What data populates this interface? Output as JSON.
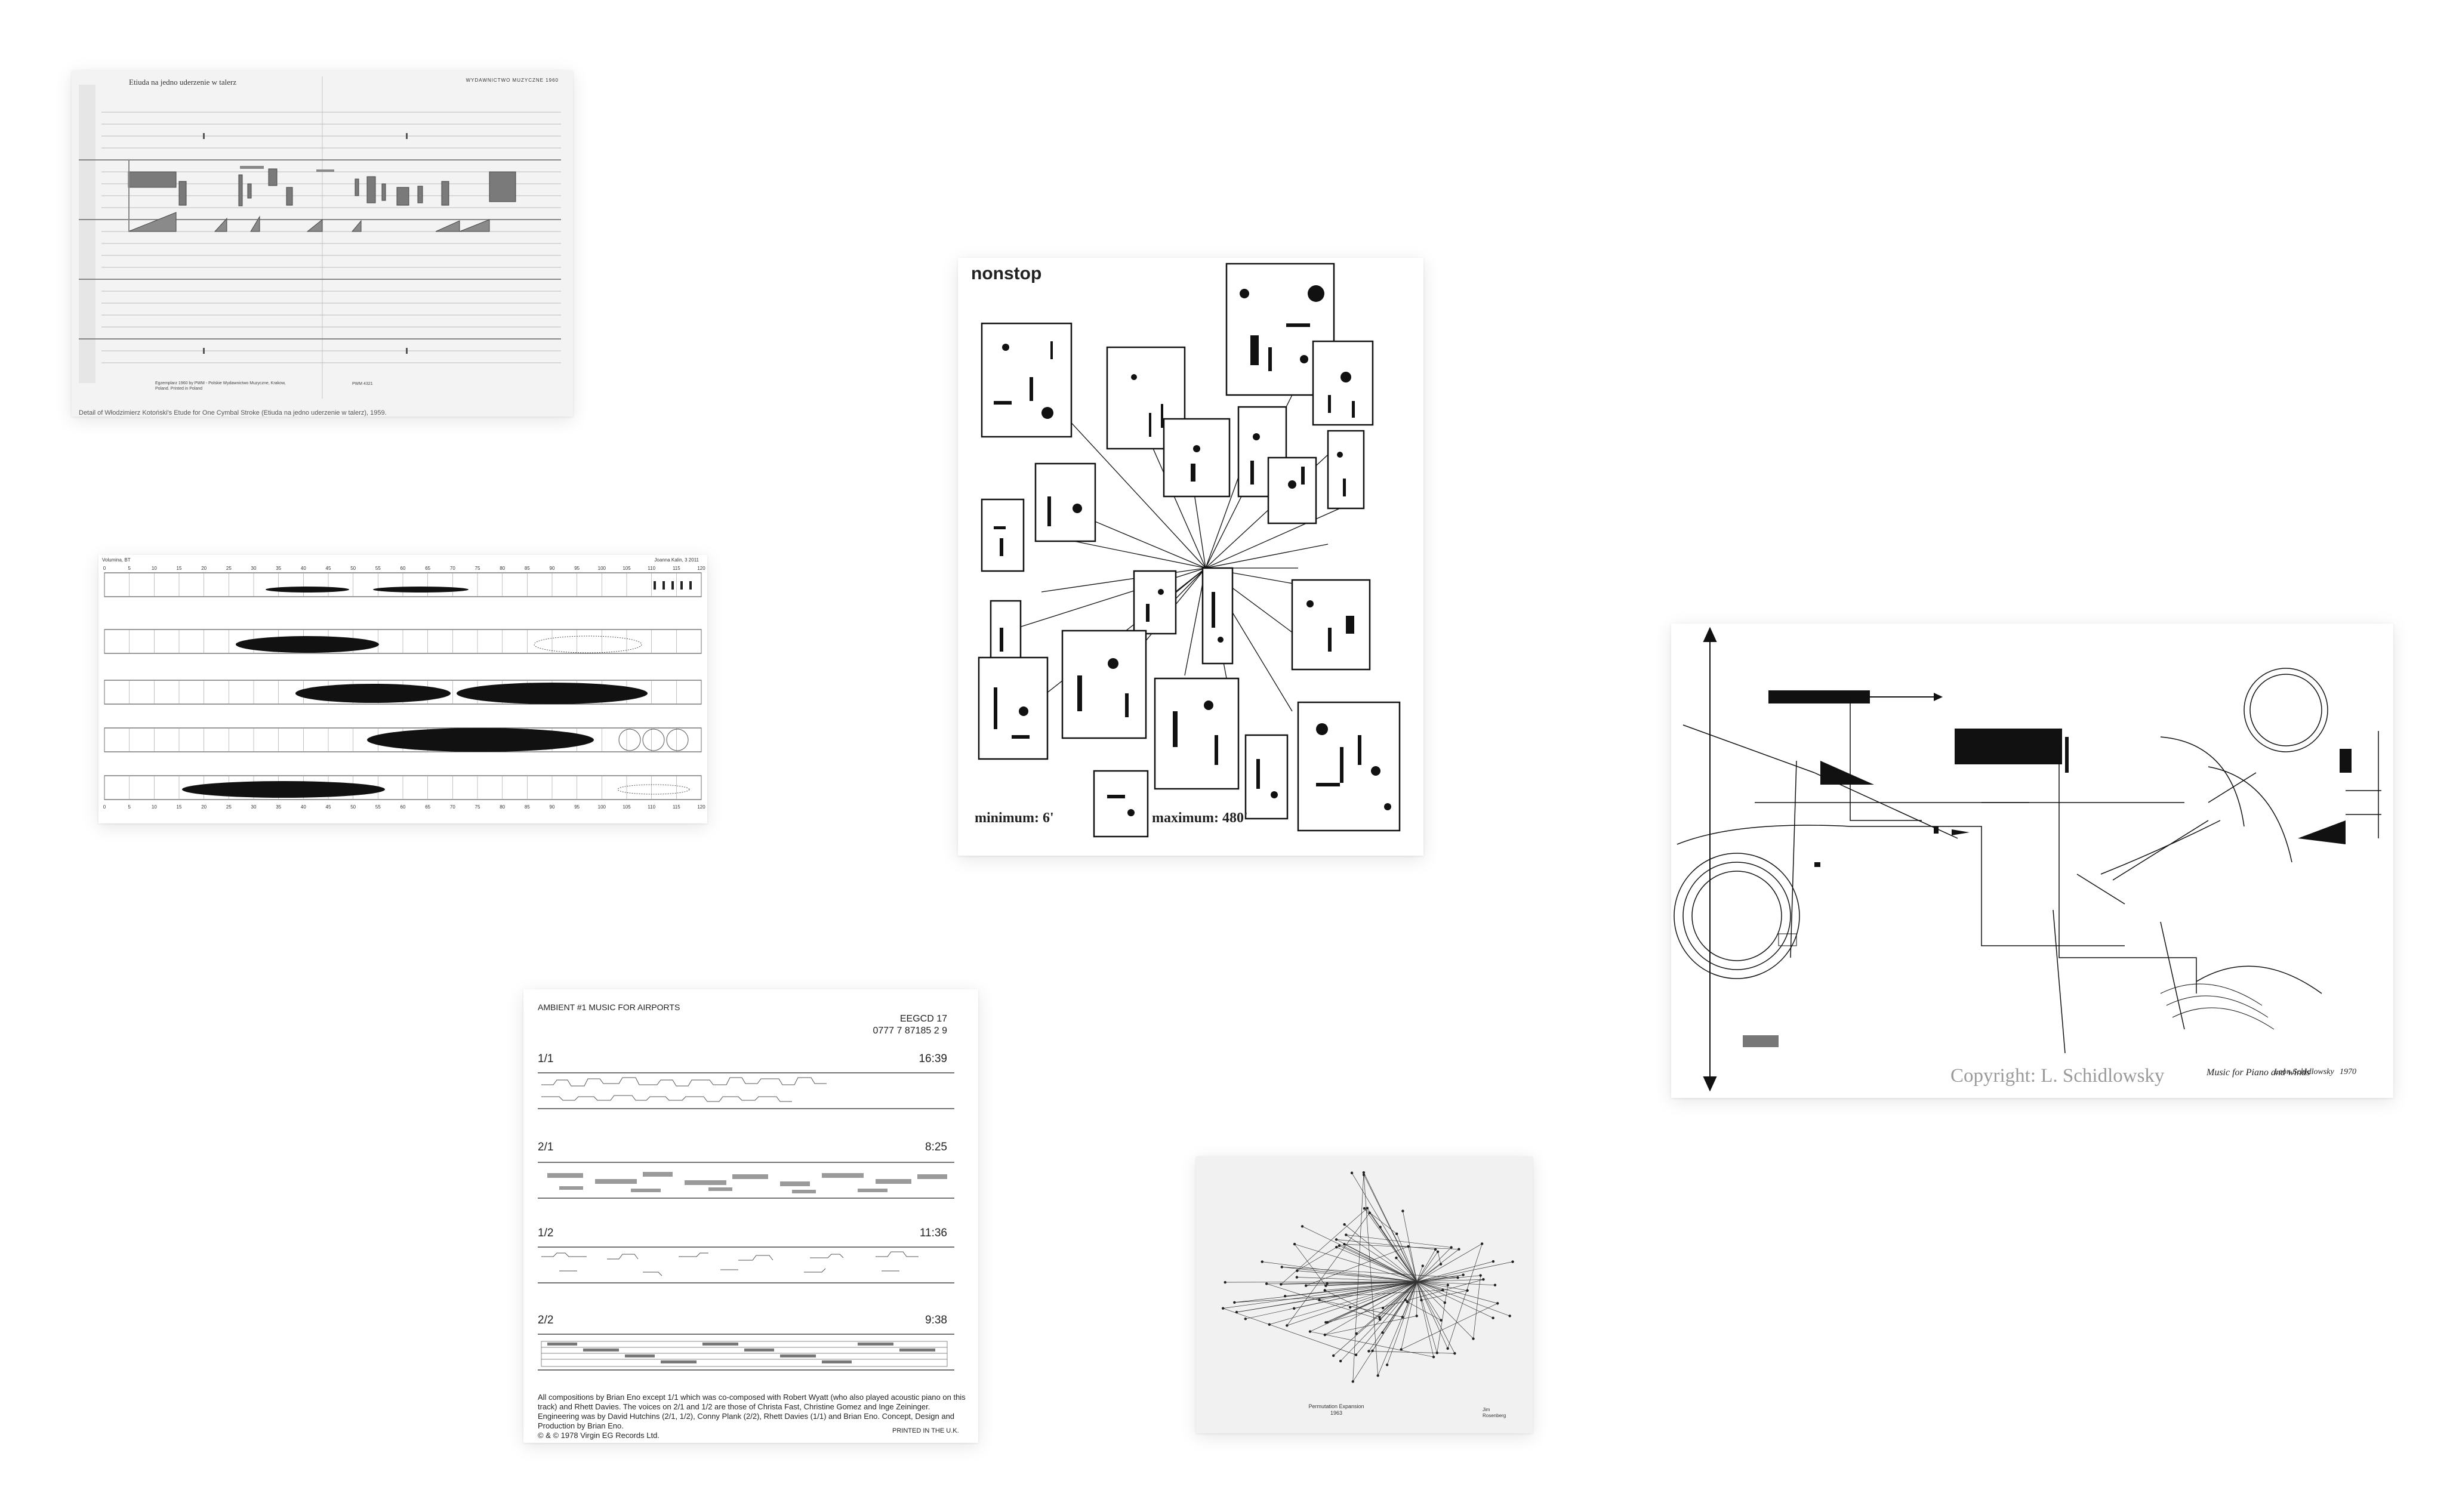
{
  "cards": {
    "etude": {
      "title": "Etiuda na jedno uderzenie w talerz",
      "header_right": "WYDAWNICTWO MUZYCZNE 1960",
      "footer_left": "Egzemplarz 1960 by PWM - Polskie Wydawnictwo Muzyczne, Krakow, Poland. Printed in Poland",
      "footer_right": "PWM 4321",
      "caption": "Detail of Włodzimierz Kotoński's Etude for One Cymbal Stroke (Etiuda na jedno uderzenie w talerz), 1959."
    },
    "volumina": {
      "header_left": "Volumina, BT",
      "header_right": "Joanna Kalin, 3 2011",
      "ticks": [
        "0",
        "5",
        "10",
        "15",
        "20",
        "25",
        "30",
        "35",
        "40",
        "45",
        "50",
        "55",
        "60",
        "65",
        "70",
        "75",
        "80",
        "85",
        "90",
        "95",
        "100",
        "105",
        "110",
        "115",
        "120"
      ]
    },
    "nonstop": {
      "title": "nonstop",
      "minimum": "minimum: 6'",
      "maximum": "maximum: 480'"
    },
    "schidlowsky": {
      "copyright": "Copyright: L. Schidlowsky",
      "signature_title": "Music for Piano and winds",
      "signature_name": "Leon Schidlowsky",
      "signature_date": "1970"
    },
    "airports": {
      "title": "AMBIENT #1 MUSIC FOR AIRPORTS",
      "code": "EEGCD 17",
      "barcode": "0777 7 87185 2 9",
      "tracks": [
        {
          "label": "1/1",
          "time": "16:39"
        },
        {
          "label": "2/1",
          "time": "8:25"
        },
        {
          "label": "1/2",
          "time": "11:36"
        },
        {
          "label": "2/2",
          "time": "9:38"
        }
      ],
      "notes": "All compositions by Brian Eno except 1/1 which was co-composed with Robert Wyatt (who also played acoustic piano on this track) and Rhett Davies. The voices on 2/1 and 1/2 are those of Christa Fast, Christine Gomez and Inge Zeininger. Engineering was by David Hutchins (2/1, 1/2), Conny Plank (2/2), Rhett Davies (1/1) and Brian Eno. Concept, Design and Production by Brian Eno.",
      "copyright": "© & © 1978 Virgin EG Records Ltd.",
      "printed": "PRINTED IN THE U.K."
    },
    "permutation": {
      "title_line1": "Permutation Expansion",
      "title_line2": "1963",
      "signature_line1": "Jim",
      "signature_line2": "Rosenberg"
    }
  }
}
